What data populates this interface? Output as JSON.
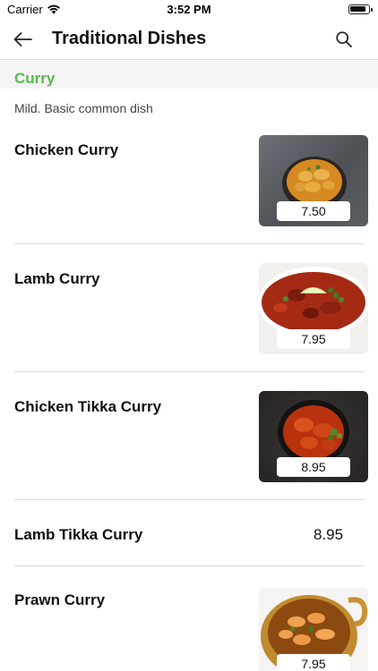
{
  "status_bar": {
    "carrier": "Carrier",
    "time": "3:52 PM",
    "icons": [
      "wifi-icon",
      "battery-icon"
    ]
  },
  "nav": {
    "title": "Traditional Dishes",
    "back_icon": "arrow-left-icon",
    "search_icon": "search-icon"
  },
  "section": {
    "title": "Curry",
    "title_color": "#56b84c",
    "description": "Mild. Basic common dish"
  },
  "items": [
    {
      "name": "Chicken Curry",
      "price": "7.50",
      "image": "chicken-curry-photo"
    },
    {
      "name": "Lamb Curry",
      "price": "7.95",
      "image": "lamb-curry-photo"
    },
    {
      "name": "Chicken Tikka Curry",
      "price": "8.95",
      "image": "chicken-tikka-curry-photo"
    },
    {
      "name": "Lamb Tikka Curry",
      "price": "8.95"
    },
    {
      "name": "Prawn Curry",
      "price": "7.95",
      "image": "prawn-curry-photo"
    }
  ]
}
